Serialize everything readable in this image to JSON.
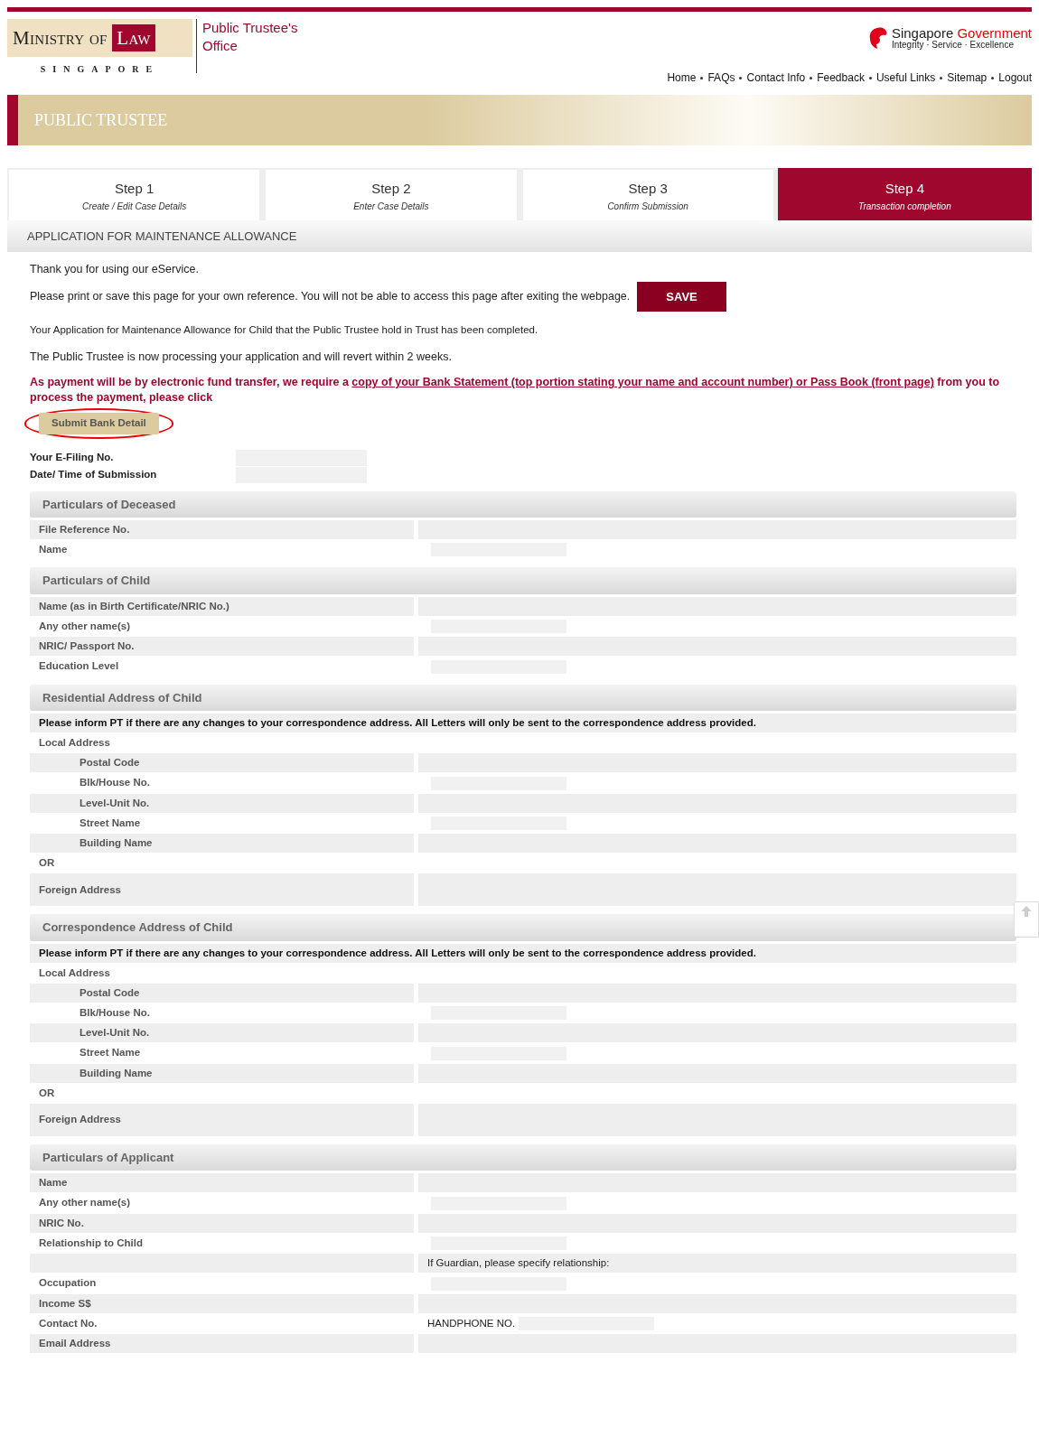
{
  "header": {
    "ministry": "Ministry of Law",
    "country": "SINGAPORE",
    "office": "Public Trustee's Office",
    "gov_name": "Singapore",
    "gov_word": "Government",
    "gov_motto": "Integrity · Service · Excellence"
  },
  "nav": [
    "Home",
    "FAQs",
    "Contact Info",
    "Feedback",
    "Useful Links",
    "Sitemap",
    "Logout"
  ],
  "banner": "PUBLIC TRUSTEE",
  "steps": [
    {
      "title": "Step 1",
      "subtitle": "Create / Edit Case Details",
      "selected": false
    },
    {
      "title": "Step 2",
      "subtitle": "Enter Case Details",
      "selected": false
    },
    {
      "title": "Step 3",
      "subtitle": "Confirm Submission",
      "selected": false
    },
    {
      "title": "Step 4",
      "subtitle": "Transaction completion",
      "selected": true
    }
  ],
  "page_title": "APPLICATION FOR MAINTENANCE ALLOWANCE",
  "intro": {
    "thanks": "Thank you for using our eService.",
    "print_note": "Please print or save this page for your own reference. You will not be able to access this page after exiting the webpage.",
    "save_button": "SAVE",
    "completed": "Your Application for Maintenance Allowance for Child that the Public Trustee hold in Trust has been completed.",
    "processing": "The Public Trustee is now processing your application and will revert within 2 weeks.",
    "payment_before": "As payment will be by electronic fund transfer, we require a",
    "payment_link": "copy of your Bank Statement (top portion stating your name and account number) or Pass Book (front page)",
    "payment_after": "from you to process the payment, please click",
    "bank_button": "Submit Bank Detail"
  },
  "summary": [
    {
      "label": "Your E-Filing No."
    },
    {
      "label": "Date/ Time of Submission"
    }
  ],
  "sections": [
    {
      "title": "Particulars of Deceased",
      "rows": [
        {
          "kind": "field",
          "label": "File Reference No."
        },
        {
          "kind": "plain",
          "label": "Name"
        }
      ]
    },
    {
      "title": "Particulars of Child",
      "rows": [
        {
          "kind": "field",
          "label": "Name (as in Birth Certificate/NRIC No.)"
        },
        {
          "kind": "plain",
          "label": "Any other name(s)"
        },
        {
          "kind": "field",
          "label": "NRIC/ Passport No."
        },
        {
          "kind": "plain",
          "label": "Education Level"
        }
      ]
    },
    {
      "title": "Residential Address of Child",
      "rows": [
        {
          "kind": "note",
          "label": "Please inform PT if there are any changes to your correspondence address. All Letters will only be sent to the correspondence address provided."
        },
        {
          "kind": "label",
          "label": "Local Address"
        },
        {
          "kind": "sub",
          "label": "Postal Code"
        },
        {
          "kind": "subplain",
          "label": "Blk/House No."
        },
        {
          "kind": "sub",
          "label": "Level-Unit No."
        },
        {
          "kind": "subplain",
          "label": "Street Name"
        },
        {
          "kind": "sub",
          "label": "Building Name"
        },
        {
          "kind": "label",
          "label": "OR"
        },
        {
          "kind": "tall",
          "label": "Foreign Address"
        }
      ]
    },
    {
      "title": "Correspondence Address of Child",
      "rows": [
        {
          "kind": "note",
          "label": "Please inform PT if there are any changes to your correspondence address. All Letters will only be sent to the correspondence address provided."
        },
        {
          "kind": "label",
          "label": "Local Address"
        },
        {
          "kind": "sub",
          "label": "Postal Code"
        },
        {
          "kind": "subplain",
          "label": "Blk/House No."
        },
        {
          "kind": "sub",
          "label": "Level-Unit No."
        },
        {
          "kind": "subplain",
          "label": "Street Name"
        },
        {
          "kind": "sub",
          "label": "Building Name"
        },
        {
          "kind": "label",
          "label": "OR"
        },
        {
          "kind": "tall",
          "label": "Foreign Address"
        }
      ]
    },
    {
      "title": "Particulars of Applicant",
      "rows": [
        {
          "kind": "field",
          "label": "Name"
        },
        {
          "kind": "plain",
          "label": "Any other name(s)"
        },
        {
          "kind": "field",
          "label": "NRIC No."
        },
        {
          "kind": "plain",
          "label": "Relationship to Child"
        },
        {
          "kind": "field",
          "label": "",
          "value": "If Guardian, please specify relationship:"
        },
        {
          "kind": "plain",
          "label": "Occupation"
        },
        {
          "kind": "field",
          "label": "Income S$"
        },
        {
          "kind": "plain",
          "label": "Contact No.",
          "value": "HANDPHONE NO."
        },
        {
          "kind": "field",
          "label": "Email Address"
        }
      ]
    }
  ]
}
